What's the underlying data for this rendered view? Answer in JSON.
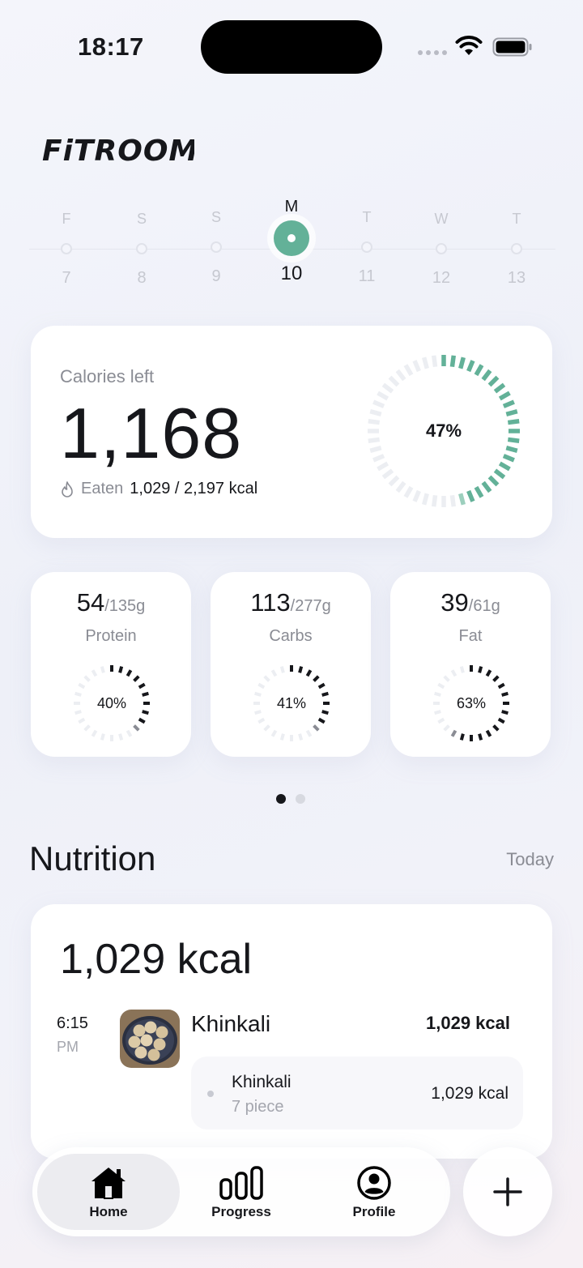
{
  "status_bar": {
    "time": "18:17"
  },
  "app": {
    "logo_text": "FiTROOM"
  },
  "week": {
    "days": [
      {
        "label": "F",
        "date": "7",
        "active": false
      },
      {
        "label": "S",
        "date": "8",
        "active": false
      },
      {
        "label": "S",
        "date": "9",
        "active": false
      },
      {
        "label": "M",
        "date": "10",
        "active": true
      },
      {
        "label": "T",
        "date": "11",
        "active": false
      },
      {
        "label": "W",
        "date": "12",
        "active": false
      },
      {
        "label": "T",
        "date": "13",
        "active": false
      }
    ]
  },
  "calories": {
    "label": "Calories left",
    "value": "1,168",
    "eaten_label": "Eaten",
    "eaten_value": "1,029 / 2,197 kcal",
    "percent_label": "47%",
    "percent": 0.47,
    "accent_color": "#63b198"
  },
  "macros": {
    "protein": {
      "value": "54",
      "goal": "/135g",
      "name": "Protein",
      "percent_label": "40%",
      "percent": 0.4
    },
    "carbs": {
      "value": "113",
      "goal": "/277g",
      "name": "Carbs",
      "percent_label": "41%",
      "percent": 0.41
    },
    "fat": {
      "value": "39",
      "goal": "/61g",
      "name": "Fat",
      "percent_label": "63%",
      "percent": 0.63
    }
  },
  "pager": {
    "count": 2,
    "active": 0
  },
  "nutrition": {
    "title": "Nutrition",
    "period": "Today",
    "total": "1,029 kcal",
    "meal": {
      "time": "6:15",
      "ampm": "PM",
      "name": "Khinkali",
      "kcal": "1,029 kcal",
      "item": {
        "name": "Khinkali",
        "quantity": "7 piece",
        "kcal": "1,029 kcal"
      }
    }
  },
  "tabbar": {
    "home": "Home",
    "progress": "Progress",
    "profile": "Profile"
  },
  "icons": {
    "add": "plus-icon",
    "home": "house-icon",
    "progress": "bar-chart-icon",
    "profile": "user-circle-icon",
    "eaten": "flame-icon"
  }
}
